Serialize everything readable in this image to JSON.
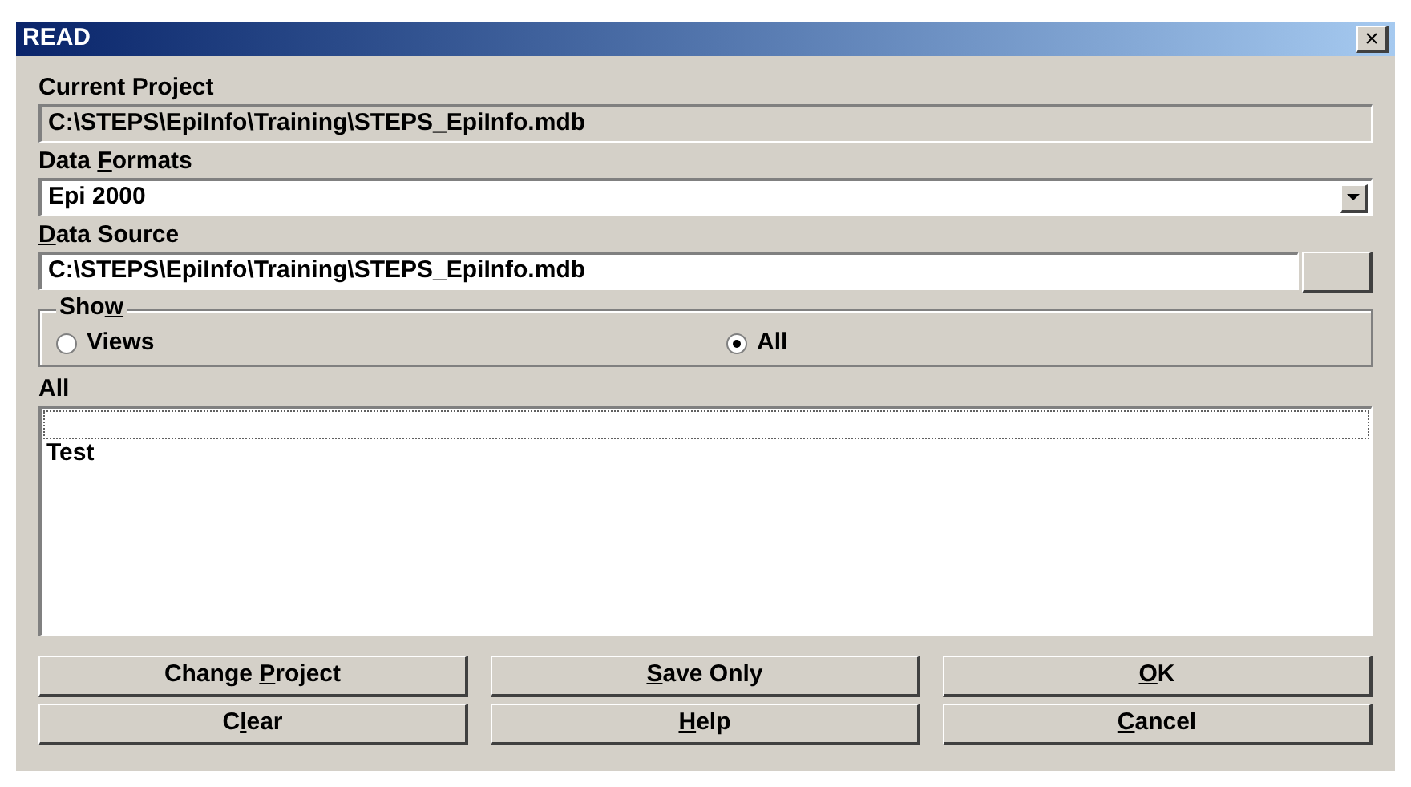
{
  "window": {
    "title": "READ",
    "close": "×"
  },
  "current_project": {
    "label": "Current Project",
    "value": "C:\\STEPS\\EpiInfo\\Training\\STEPS_EpiInfo.mdb"
  },
  "data_formats": {
    "label": [
      {
        "text": "Data ",
        "underlined": false
      },
      {
        "text": "F",
        "underlined": true
      },
      {
        "text": "ormats",
        "underlined": false
      }
    ],
    "value": "Epi 2000"
  },
  "data_source": {
    "label": [
      {
        "text": "D",
        "underlined": true
      },
      {
        "text": "ata Source",
        "underlined": false
      }
    ],
    "value": "C:\\STEPS\\EpiInfo\\Training\\STEPS_EpiInfo.mdb"
  },
  "show": {
    "label": [
      {
        "text": "Sho",
        "underlined": false
      },
      {
        "text": "w",
        "underlined": true
      }
    ],
    "options": [
      {
        "label": "Views",
        "selected": false
      },
      {
        "label": "All",
        "selected": true
      }
    ]
  },
  "list": {
    "label": "All",
    "items": [
      {
        "label": "Test"
      }
    ]
  },
  "buttons": [
    {
      "label": [
        {
          "text": "Change ",
          "underlined": false
        },
        {
          "text": "P",
          "underlined": true
        },
        {
          "text": "roject",
          "underlined": false
        }
      ]
    },
    {
      "label": [
        {
          "text": "S",
          "underlined": true
        },
        {
          "text": "ave Only",
          "underlined": false
        }
      ]
    },
    {
      "label": [
        {
          "text": "O",
          "underlined": true
        },
        {
          "text": "K",
          "underlined": false
        }
      ]
    },
    {
      "label": [
        {
          "text": "C",
          "underlined": false
        },
        {
          "text": "l",
          "underlined": true
        },
        {
          "text": "ear",
          "underlined": false
        }
      ]
    },
    {
      "label": [
        {
          "text": "H",
          "underlined": true
        },
        {
          "text": "elp",
          "underlined": false
        }
      ]
    },
    {
      "label": [
        {
          "text": "C",
          "underlined": true
        },
        {
          "text": "ancel",
          "underlined": false
        }
      ]
    }
  ]
}
